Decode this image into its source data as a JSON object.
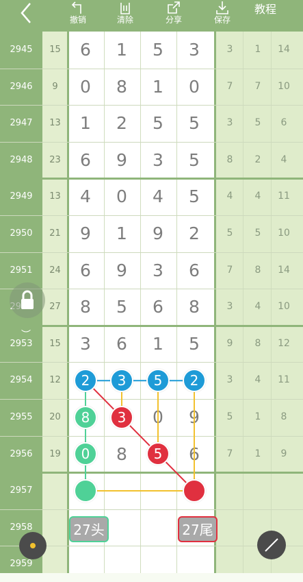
{
  "toolbar": {
    "undo": "撤销",
    "clear": "清除",
    "share": "分享",
    "save": "保存",
    "tutorial": "教程"
  },
  "rows": [
    {
      "issue": "2945",
      "sum": "15",
      "digits": [
        "6",
        "1",
        "5",
        "3"
      ],
      "right": [
        "3",
        "1",
        "14"
      ]
    },
    {
      "issue": "2946",
      "sum": "9",
      "digits": [
        "0",
        "8",
        "1",
        "0"
      ],
      "right": [
        "7",
        "7",
        "10"
      ]
    },
    {
      "issue": "2947",
      "sum": "13",
      "digits": [
        "1",
        "2",
        "5",
        "5"
      ],
      "right": [
        "3",
        "5",
        "6"
      ]
    },
    {
      "issue": "2948",
      "sum": "23",
      "digits": [
        "6",
        "9",
        "3",
        "5"
      ],
      "right": [
        "8",
        "2",
        "4"
      ]
    },
    {
      "issue": "2949",
      "sum": "13",
      "digits": [
        "4",
        "0",
        "4",
        "5"
      ],
      "right": [
        "4",
        "4",
        "11"
      ]
    },
    {
      "issue": "2950",
      "sum": "21",
      "digits": [
        "9",
        "1",
        "9",
        "2"
      ],
      "right": [
        "5",
        "5",
        "10"
      ]
    },
    {
      "issue": "2951",
      "sum": "24",
      "digits": [
        "6",
        "9",
        "3",
        "6"
      ],
      "right": [
        "7",
        "8",
        "14"
      ]
    },
    {
      "issue": "2952",
      "sum": "27",
      "digits": [
        "8",
        "5",
        "6",
        "8"
      ],
      "right": [
        "3",
        "4",
        "10"
      ]
    },
    {
      "issue": "2953",
      "sum": "15",
      "digits": [
        "3",
        "6",
        "1",
        "5"
      ],
      "right": [
        "9",
        "8",
        "12"
      ]
    },
    {
      "issue": "2954",
      "sum": "12",
      "digits": [
        "2",
        "3",
        "5",
        "2"
      ],
      "right": [
        "3",
        "4",
        "11"
      ]
    },
    {
      "issue": "2955",
      "sum": "20",
      "digits": [
        "8",
        "3",
        "0",
        "9"
      ],
      "right": [
        "5",
        "1",
        "8"
      ]
    },
    {
      "issue": "2956",
      "sum": "19",
      "digits": [
        "0",
        "8",
        "5",
        "6"
      ],
      "right": [
        "7",
        "1",
        "9"
      ]
    },
    {
      "issue": "2957",
      "sum": "",
      "digits": [
        "",
        "",
        "",
        ""
      ],
      "right": [
        "",
        "",
        ""
      ]
    },
    {
      "issue": "2958",
      "sum": "",
      "digits": [
        "",
        "",
        "",
        ""
      ],
      "right": [
        "",
        "",
        ""
      ]
    },
    {
      "issue": "2959",
      "sum": "",
      "digits": [
        "",
        "",
        "",
        ""
      ],
      "right": [
        "",
        "",
        ""
      ]
    }
  ],
  "labels": {
    "head": "27头",
    "tail": "27尾"
  },
  "colors": {
    "toolbar": "#8fb57a",
    "blue": "#1e9bd7",
    "red": "#e0303f",
    "green": "#4fd197",
    "yellow": "#f2c12e"
  }
}
